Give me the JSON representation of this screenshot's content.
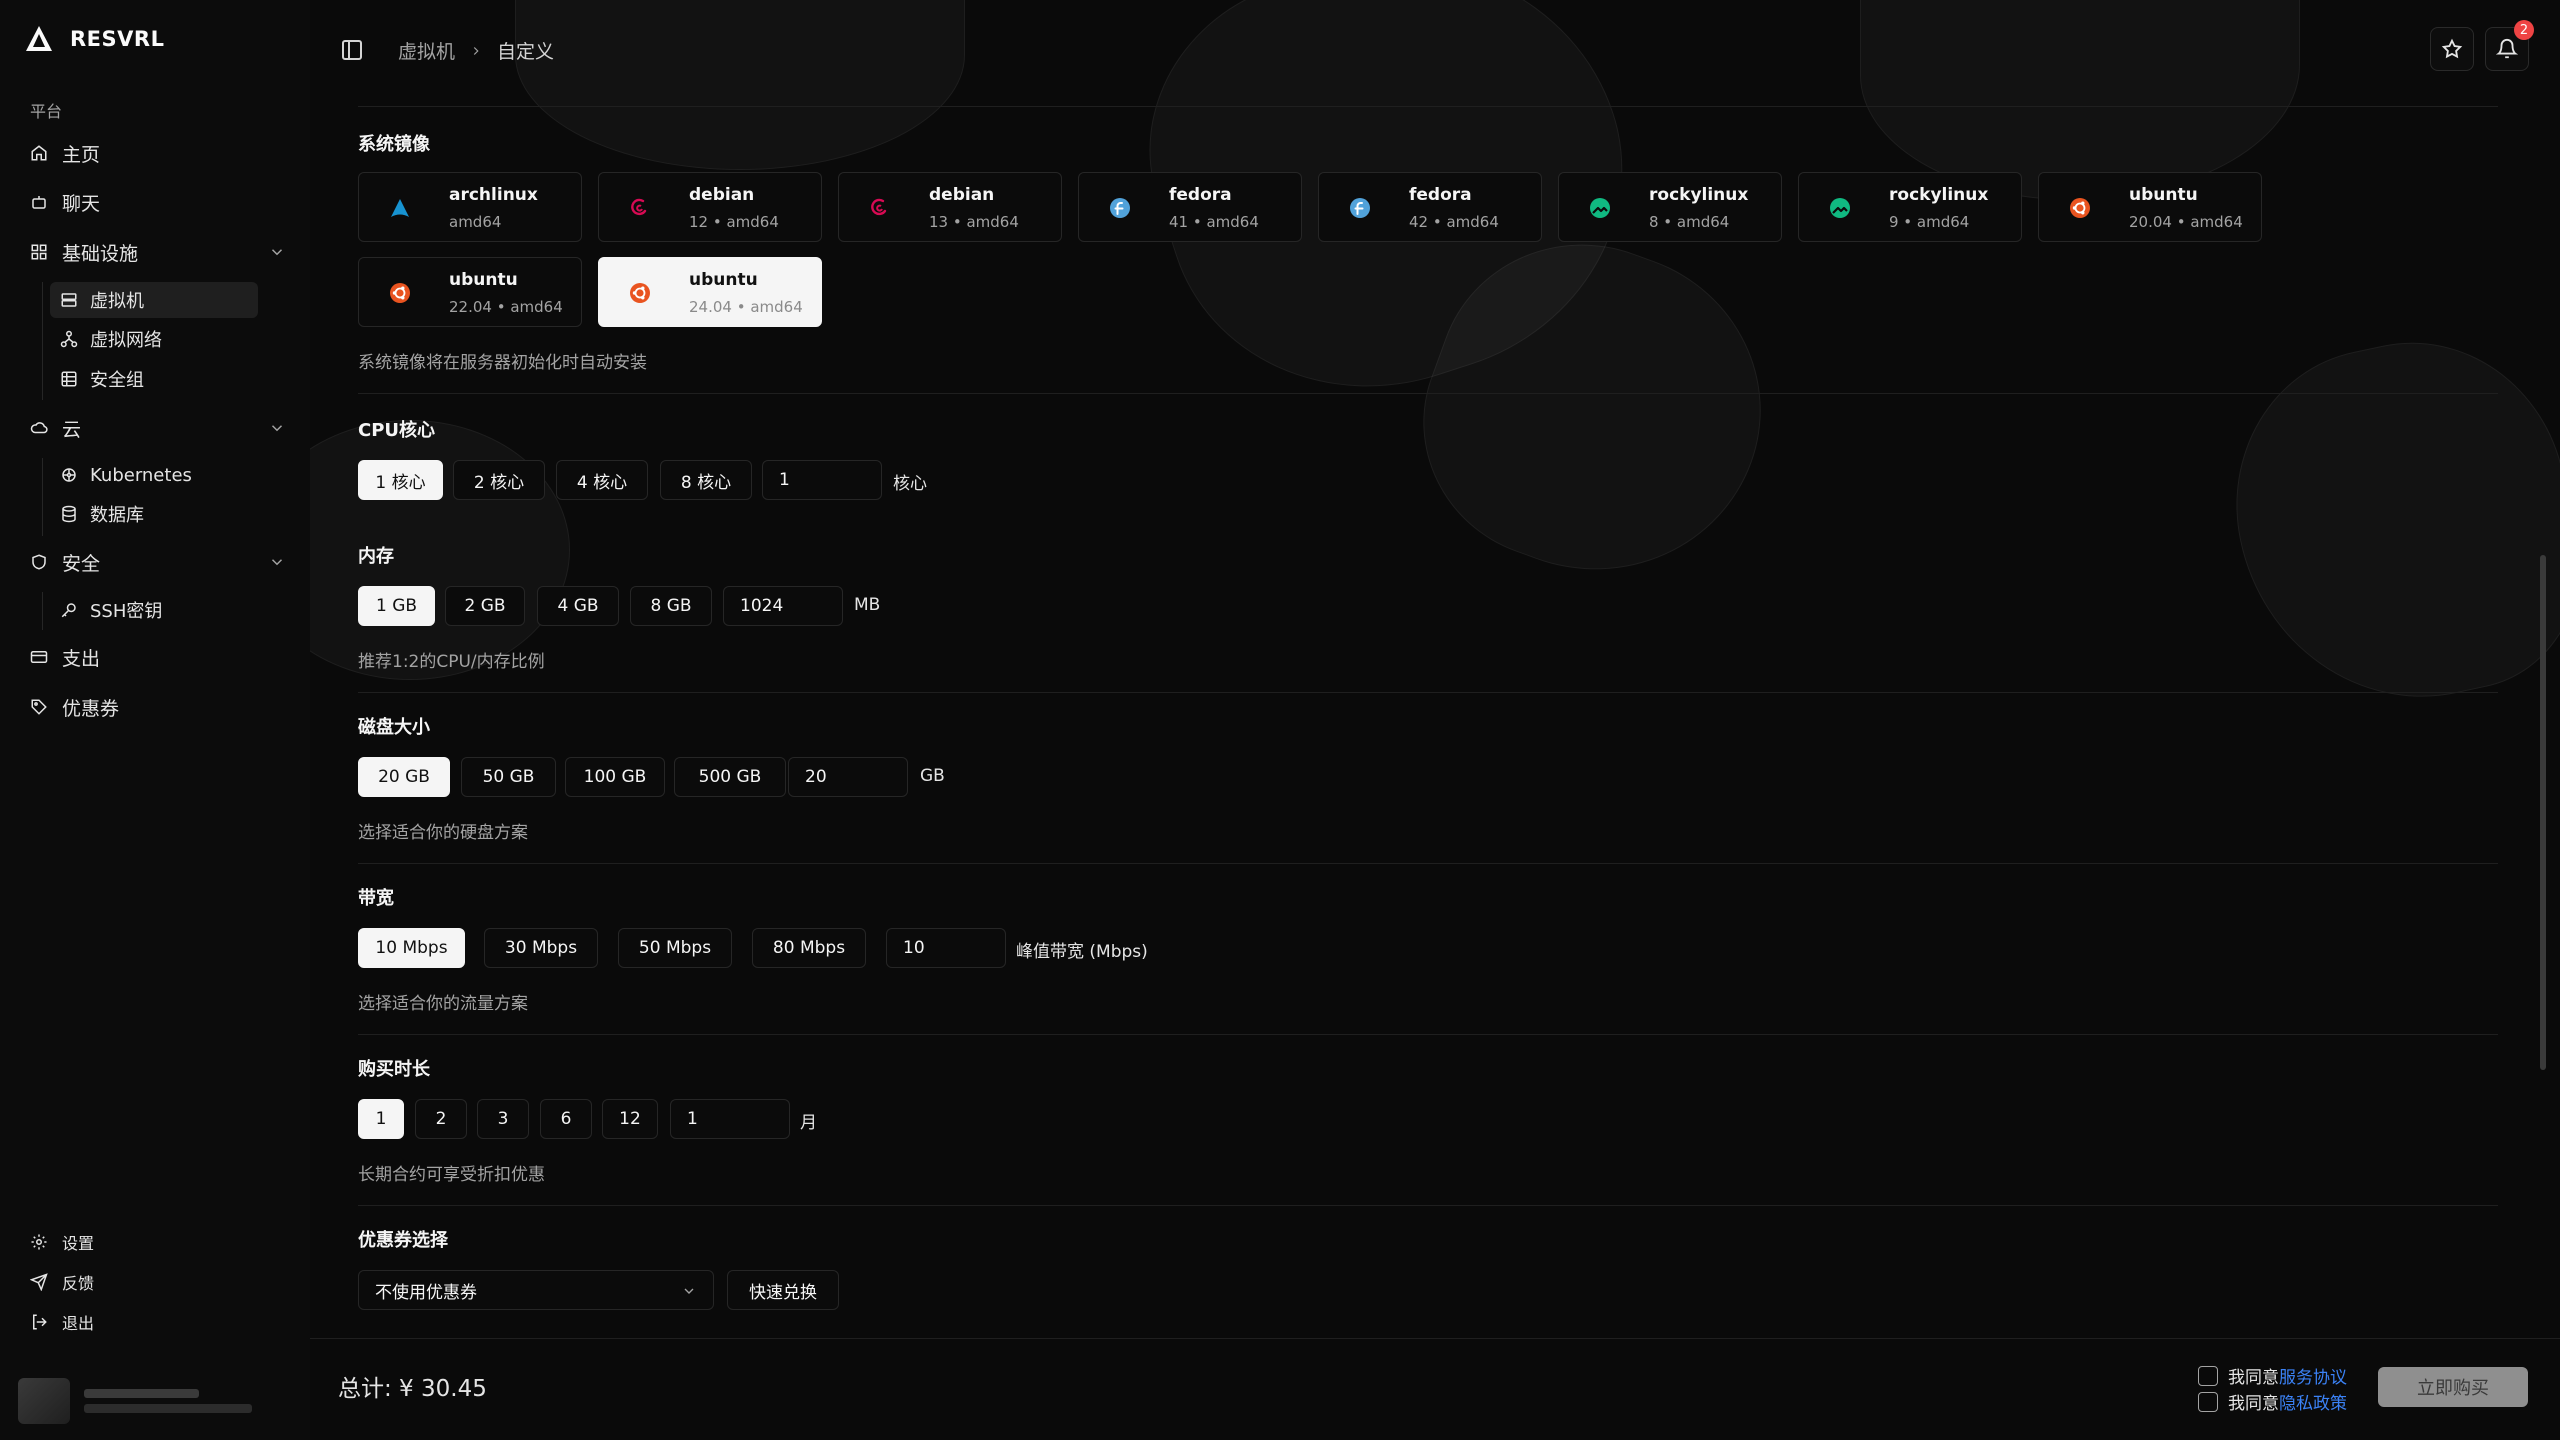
{
  "brand": {
    "name": "RESVRL"
  },
  "sidebar": {
    "section_label": "平台",
    "home": "主页",
    "chat": "聊天",
    "infra": "基础设施",
    "vm": "虚拟机",
    "vnet": "虚拟网络",
    "secgroup": "安全组",
    "cloud": "云",
    "kubernetes": "Kubernetes",
    "database": "数据库",
    "security": "安全",
    "ssh": "SSH密钥",
    "billing": "支出",
    "coupons": "优惠券",
    "settings": "设置",
    "feedback": "反馈",
    "logout": "退出"
  },
  "header": {
    "crumb_1": "虚拟机",
    "crumb_2": "自定义",
    "notification_count": "2"
  },
  "os": {
    "title": "系统镜像",
    "hint": "系统镜像将在服务器初始化时自动安装",
    "images": [
      {
        "name": "archlinux",
        "meta": "amd64",
        "icon": "archlinux-icon",
        "color": "#1793d1"
      },
      {
        "name": "debian",
        "meta": "12 • amd64",
        "icon": "debian-icon",
        "color": "#d70a53"
      },
      {
        "name": "debian",
        "meta": "13 • amd64",
        "icon": "debian-icon",
        "color": "#d70a53"
      },
      {
        "name": "fedora",
        "meta": "41 • amd64",
        "icon": "fedora-icon",
        "color": "#51a2da"
      },
      {
        "name": "fedora",
        "meta": "42 • amd64",
        "icon": "fedora-icon",
        "color": "#51a2da"
      },
      {
        "name": "rockylinux",
        "meta": "8 • amd64",
        "icon": "rockylinux-icon",
        "color": "#10b981"
      },
      {
        "name": "rockylinux",
        "meta": "9 • amd64",
        "icon": "rockylinux-icon",
        "color": "#10b981"
      },
      {
        "name": "ubuntu",
        "meta": "20.04 • amd64",
        "icon": "ubuntu-icon",
        "color": "#e95420"
      },
      {
        "name": "ubuntu",
        "meta": "22.04 • amd64",
        "icon": "ubuntu-icon",
        "color": "#e95420"
      },
      {
        "name": "ubuntu",
        "meta": "24.04 • amd64",
        "icon": "ubuntu-icon",
        "color": "#e95420",
        "selected": true
      }
    ]
  },
  "cpu": {
    "title": "CPU核心",
    "options": [
      "1 核心",
      "2 核心",
      "4 核心",
      "8 核心"
    ],
    "input": "1",
    "unit": "核心"
  },
  "memory": {
    "title": "内存",
    "options": [
      "1 GB",
      "2 GB",
      "4 GB",
      "8 GB"
    ],
    "input": "1024",
    "unit": "MB",
    "hint": "推荐1:2的CPU/内存比例"
  },
  "disk": {
    "title": "磁盘大小",
    "options": [
      "20 GB",
      "50 GB",
      "100 GB",
      "500 GB"
    ],
    "input": "20",
    "unit": "GB",
    "hint": "选择适合你的硬盘方案"
  },
  "bandwidth": {
    "title": "带宽",
    "options": [
      "10 Mbps",
      "30 Mbps",
      "50 Mbps",
      "80 Mbps"
    ],
    "input": "10",
    "unit": "峰值带宽 (Mbps)",
    "hint": "选择适合你的流量方案"
  },
  "duration": {
    "title": "购买时长",
    "options": [
      "1",
      "2",
      "3",
      "6",
      "12"
    ],
    "input": "1",
    "unit": "月",
    "hint": "长期合约可享受折扣优惠"
  },
  "coupon": {
    "title": "优惠券选择",
    "selected": "不使用优惠券",
    "redeem": "快速兑换"
  },
  "footer": {
    "total": "总计: ¥ 30.45",
    "agree_prefix": "我同意",
    "tos": "服务协议",
    "privacy": "隐私政策",
    "buy": "立即购买"
  }
}
